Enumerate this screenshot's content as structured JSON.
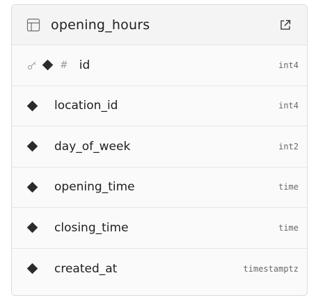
{
  "table": {
    "name": "opening_hours",
    "icon": "table-icon",
    "action_icon": "external-link-icon"
  },
  "columns": [
    {
      "name": "id",
      "type": "int4",
      "primary_key": true,
      "identity": true
    },
    {
      "name": "location_id",
      "type": "int4"
    },
    {
      "name": "day_of_week",
      "type": "int2"
    },
    {
      "name": "opening_time",
      "type": "time"
    },
    {
      "name": "closing_time",
      "type": "time"
    },
    {
      "name": "created_at",
      "type": "timestamptz"
    }
  ]
}
